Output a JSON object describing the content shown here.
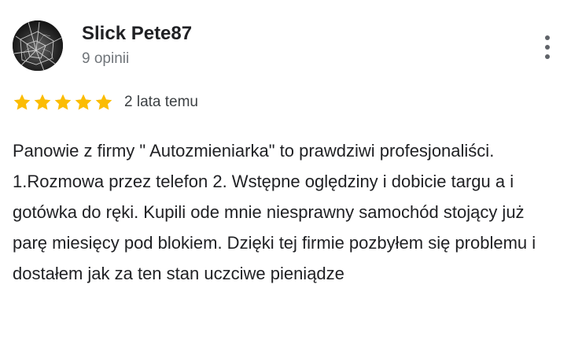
{
  "reviewer": {
    "name": "Slick Pete87",
    "review_count": "9 opinii"
  },
  "rating": {
    "stars": 5,
    "max_stars": 5,
    "date": "2 lata temu",
    "star_color": "#fbbc04"
  },
  "review": {
    "text": "Panowie z firmy \" Autozmieniarka\" to prawdziwi profesjonaliści. 1.Rozmowa przez telefon 2. Wstępne oględziny i dobicie targu a i gotówka do ręki. Kupili ode mnie niesprawny samochód stojący już parę miesięcy pod blokiem. Dzięki tej firmie pozbyłem się problemu i dostałem jak za ten stan uczciwe pieniądze"
  },
  "icons": {
    "avatar": "cracked-glass-avatar",
    "menu": "more-vert-icon",
    "star": "star-icon"
  }
}
